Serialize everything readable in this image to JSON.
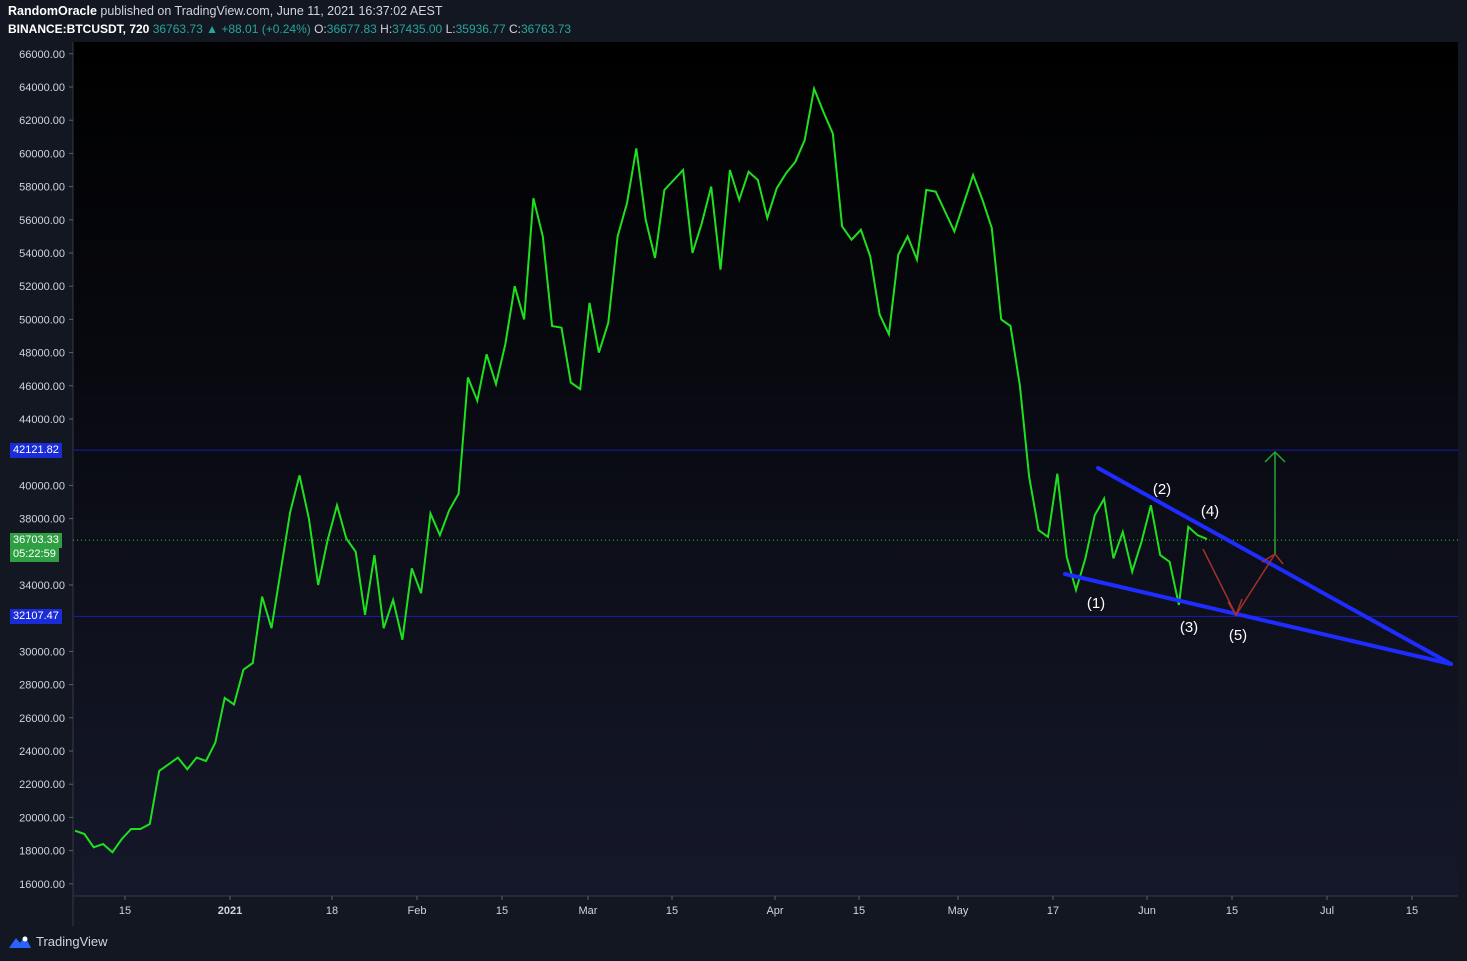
{
  "header": {
    "author": "RandomOracle",
    "published_text": " published on TradingView.com, June 11, 2021 16:37:02 AEST",
    "symbol": "BINANCE:BTCUSDT, 720",
    "last": "36763.73",
    "change_arrow": "▲",
    "change": "+88.01 (+0.24%)",
    "o_label": "O:",
    "o_value": "36677.83",
    "h_label": "H:",
    "h_value": "37435.00",
    "l_label": "L:",
    "l_value": "35936.77",
    "c_label": "C:",
    "c_value": "36763.73"
  },
  "price_badges": {
    "resistance": "42121.82",
    "current_price": "36703.33",
    "countdown": "05:22:59",
    "support": "32107.47"
  },
  "footer": {
    "brand": "TradingView",
    "logo_icon": "tradingview-logo-icon"
  },
  "colors": {
    "background": "#131722",
    "price_line": "#1fe01f",
    "trendline": "#1f2cff",
    "horizontal_level": "#1b1bb0",
    "badge_blue": "#1a2bd8",
    "badge_green": "#2ea043",
    "projection_up": "#26a632",
    "projection_down": "#a3312b"
  },
  "chart_data": {
    "type": "line",
    "y_ticks": [
      "16000.00",
      "18000.00",
      "20000.00",
      "22000.00",
      "24000.00",
      "26000.00",
      "28000.00",
      "30000.00",
      "34000.00",
      "38000.00",
      "40000.00",
      "44000.00",
      "46000.00",
      "48000.00",
      "50000.00",
      "52000.00",
      "54000.00",
      "56000.00",
      "58000.00",
      "60000.00",
      "62000.00",
      "64000.00",
      "66000.00"
    ],
    "x_ticks": [
      "15",
      "2021",
      "18",
      "Feb",
      "15",
      "Mar",
      "15",
      "Apr",
      "15",
      "May",
      "17",
      "Jun",
      "15",
      "Jul",
      "15"
    ],
    "ylim": [
      15000,
      67000
    ],
    "grid": false,
    "horizontal_levels": [
      42121.82,
      32107.47
    ],
    "current_price_line": 36703.33,
    "wave_labels": [
      "(1)",
      "(2)",
      "(3)",
      "(4)",
      "(5)"
    ],
    "series": [
      {
        "values": [
          19200,
          19000,
          18200,
          18400,
          17900,
          18700,
          19300,
          19300,
          19600,
          22800,
          23200,
          23600,
          22900,
          23600,
          23400,
          24500,
          27200,
          26800,
          28900,
          29300,
          33300,
          31400,
          34900,
          38400,
          40600,
          38000,
          34000,
          36700,
          38800,
          36800,
          36000,
          32200,
          35800,
          31400,
          33100,
          30700,
          35000,
          33500,
          38300,
          37000,
          38500,
          39500,
          46500,
          45100,
          47900,
          46100,
          48500,
          52000,
          50000,
          57300,
          55000,
          49600,
          49500,
          46200,
          45800,
          51000,
          48000,
          49800,
          55000,
          57000,
          60300,
          56000,
          53700,
          57800,
          58400,
          59000,
          54000,
          55800,
          58000,
          53000,
          59000,
          57200,
          58900,
          58400,
          56100,
          57900,
          58800,
          59500,
          60800,
          63900,
          62500,
          61200,
          55600,
          54800,
          55400,
          53800,
          50300,
          49100,
          53900,
          55000,
          53600,
          57800,
          57700,
          56500,
          55300,
          57000,
          58700,
          57200,
          55500,
          50000,
          49600,
          46000,
          40500,
          37300,
          36900,
          40700,
          35700,
          33700,
          35600,
          38200,
          39200,
          35600,
          37200,
          34800,
          36600,
          38800,
          35800,
          35400,
          32800,
          37500,
          37000,
          36764
        ]
      }
    ]
  }
}
